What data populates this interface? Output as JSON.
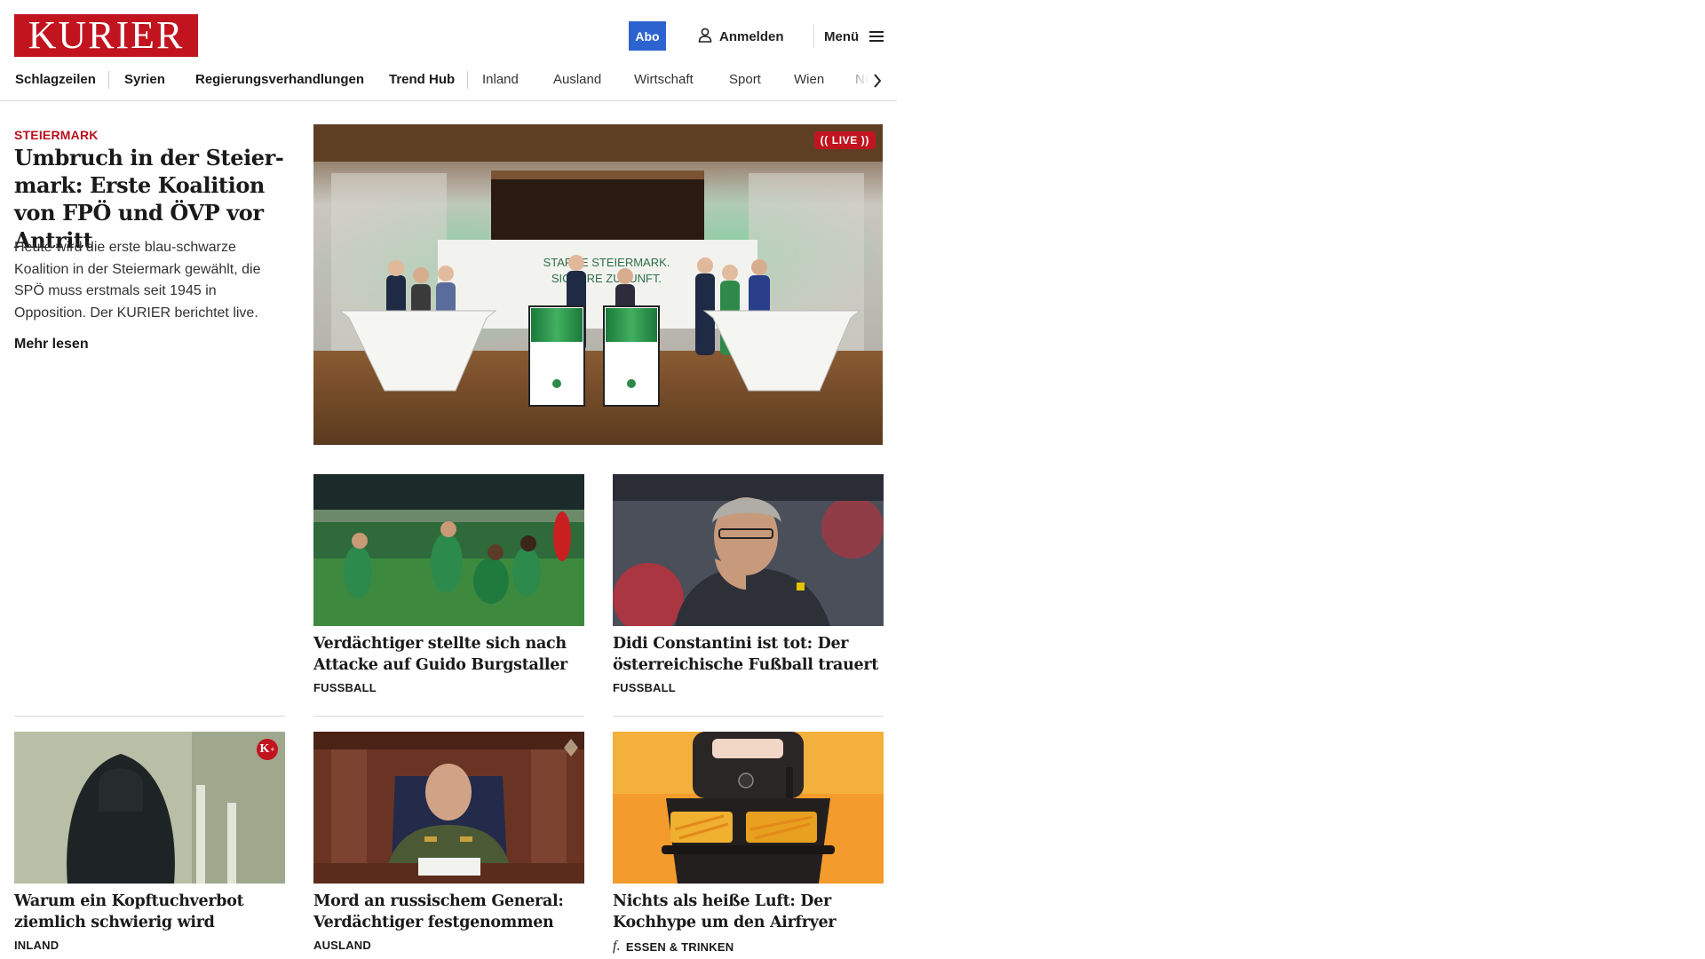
{
  "header": {
    "logo_text": "KURIER",
    "abo_label": "Abo",
    "login_label": "Anmelden",
    "menu_label": "Menü",
    "brand_color": "#c1141f",
    "abo_color": "#2d63cf"
  },
  "nav": {
    "items": [
      "Schlagzeilen",
      "Syrien",
      "Regierungsverhandlungen",
      "Trend Hub",
      "Inland",
      "Ausland",
      "Wirtschaft",
      "Sport",
      "Wien",
      "NÖ"
    ]
  },
  "lead": {
    "kicker": "STEIERMARK",
    "title": "Umbruch in der Steier­mark: Erste Koalition von FPÖ und ÖVP vor Antritt",
    "teaser": "Heute wird die erste blau-schwarze Koalition in der Steiermark gewählt, die SPÖ muss erstmals seit 1945 in Opposition. Der KURIER berichtet live.",
    "more": "Mehr lesen",
    "live_badge": "(( LIVE ))",
    "banner_text_1": "STARKE STEIERMARK.",
    "banner_text_2": "SICHERE ZUKUNFT."
  },
  "cards": [
    {
      "title": "Verdächtiger stellte sich nach Atta­cke auf Guido Burgstaller",
      "kicker": "FUSSBALL"
    },
    {
      "title": "Didi Constantini ist tot: Der öster­reichische Fußball trauert",
      "kicker": "FUSSBALL"
    },
    {
      "title": "Warum ein Kopftuchverbot ziem­lich schwierig wird",
      "kicker": "INLAND",
      "premium_badge": "K"
    },
    {
      "title": "Mord an russischem General: Ver­dächtiger festgenommen",
      "kicker": "AUSLAND"
    },
    {
      "title": "Nichts als heiße Luft: Der Koch­hype um den Airfryer",
      "kicker": "ESSEN & TRINKEN",
      "kicker_icon": "fork-icon"
    }
  ]
}
